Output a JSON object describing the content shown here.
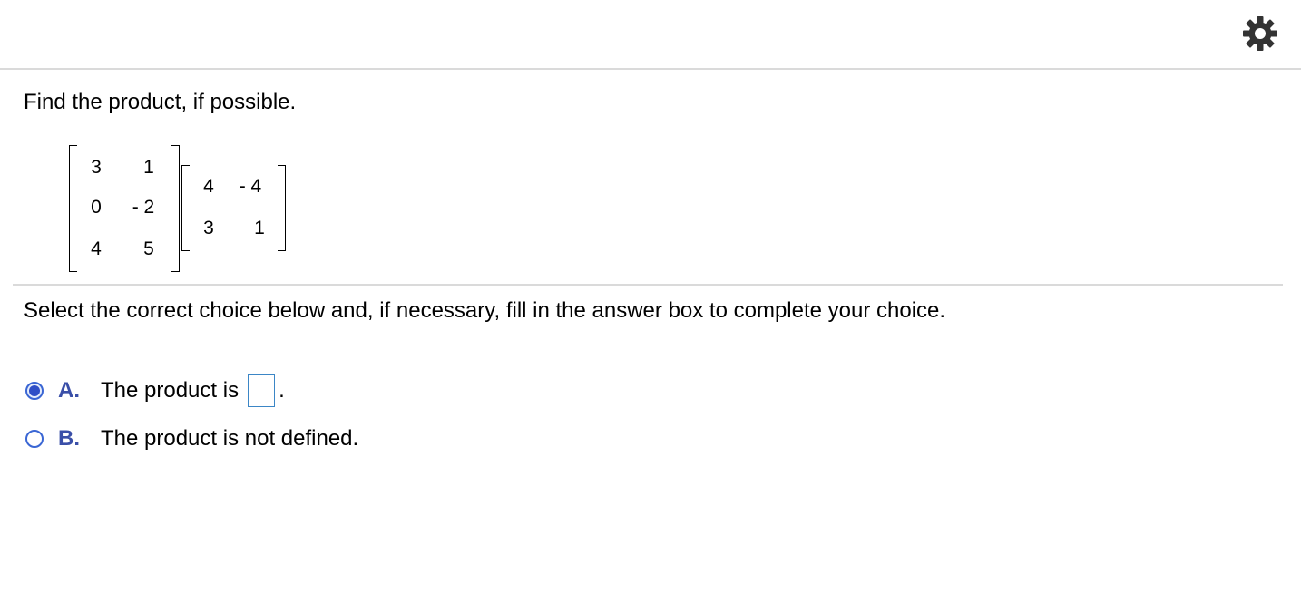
{
  "header": {
    "settings_icon": "gear-icon"
  },
  "question": {
    "prompt": "Find the product, if possible."
  },
  "matrices": {
    "left": {
      "rows": [
        [
          "3",
          "1"
        ],
        [
          "0",
          "- 2"
        ],
        [
          "4",
          "5"
        ]
      ]
    },
    "right": {
      "rows": [
        [
          "4",
          "- 4"
        ],
        [
          "3",
          "1"
        ]
      ]
    }
  },
  "instruction": "Select the correct choice below and, if necessary, fill in the answer box to complete your choice.",
  "choices": [
    {
      "letter": "A.",
      "text": "The product is",
      "selected": true,
      "answer_value": "",
      "suffix": "."
    },
    {
      "letter": "B.",
      "text": "The product is not defined.",
      "selected": false
    }
  ],
  "colors": {
    "radio_accent": "#2f4fc7",
    "choice_letter": "#3a4fa8",
    "answer_box_border": "#3b86c6",
    "divider": "#dadada"
  }
}
